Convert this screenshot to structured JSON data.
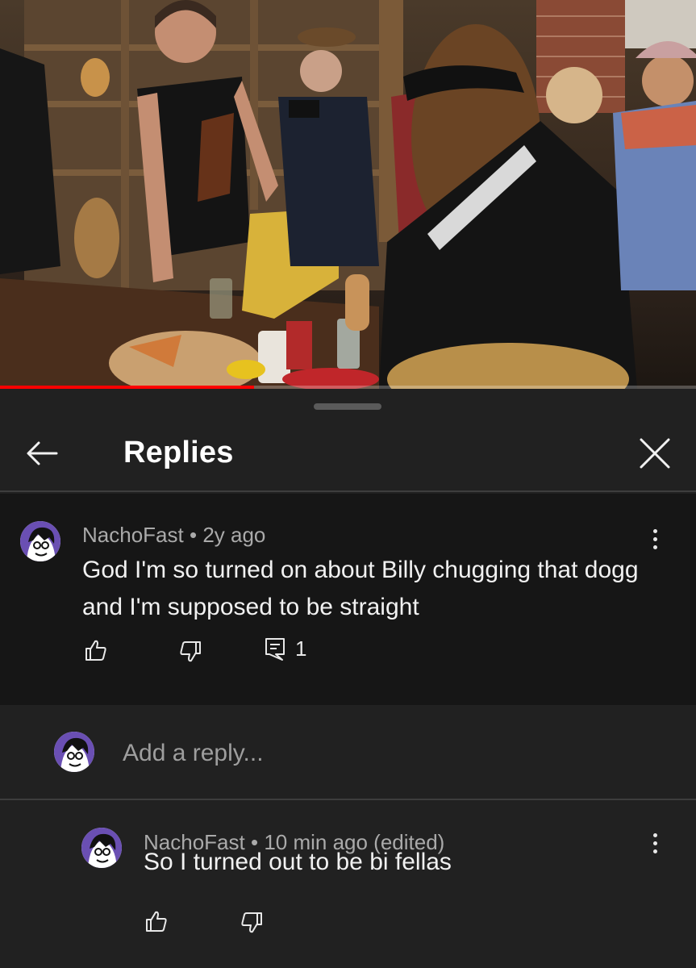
{
  "video": {
    "progress_fraction": 0.365
  },
  "header": {
    "title": "Replies",
    "back_icon": "arrow-left-icon",
    "close_icon": "close-icon"
  },
  "parent_comment": {
    "author": "NachoFast",
    "separator": "•",
    "time": "2y ago",
    "text": "God I'm so turned on about Billy chugging that dogg and I'm supposed to be straight",
    "reply_count": "1"
  },
  "add_reply": {
    "placeholder": "Add a reply..."
  },
  "reply": {
    "author": "NachoFast",
    "separator": "•",
    "time": "10 min ago (edited)",
    "text": "So I turned out to be bi fellas"
  },
  "colors": {
    "sheet_bg": "#212121",
    "parent_bg": "#161616",
    "progress": "#ff0000",
    "avatar_purple": "#6a4fb3"
  }
}
